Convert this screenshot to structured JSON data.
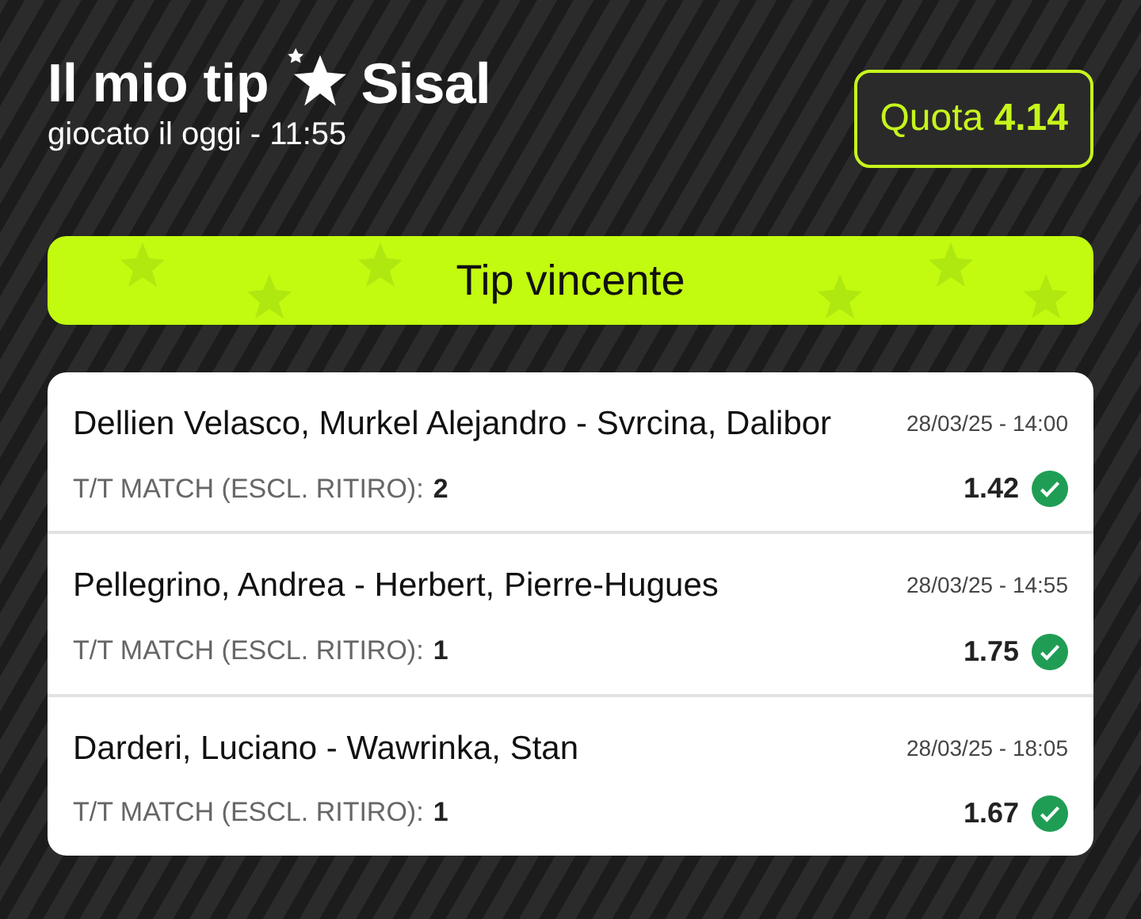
{
  "header": {
    "title": "Il mio tip",
    "brand": "Sisal",
    "subtitle": "giocato il oggi - 11:55",
    "odds": "Quota **4.14**"
  },
  "banner": {
    "label": "Tip vincente"
  },
  "bets": [
    {
      "event": "Dellien Velasco, Murkel Alejandro - Svrcina, Dalibor",
      "datetime": "28/03/25 - 14:00",
      "market": "T/T MATCH (ESCL. RITIRO):",
      "pick": "2",
      "odds": "1.42",
      "won": true
    },
    {
      "event": "Pellegrino, Andrea - Herbert, Pierre-Hugues",
      "datetime": "28/03/25 - 14:55",
      "market": "T/T MATCH (ESCL. RITIRO):",
      "pick": "1",
      "odds": "1.75",
      "won": true
    },
    {
      "event": "Darderi, Luciano - Wawrinka, Stan",
      "datetime": "28/03/25 - 18:05",
      "market": "T/T MATCH (ESCL. RITIRO):",
      "pick": "1",
      "odds": "1.67",
      "won": true
    }
  ]
}
